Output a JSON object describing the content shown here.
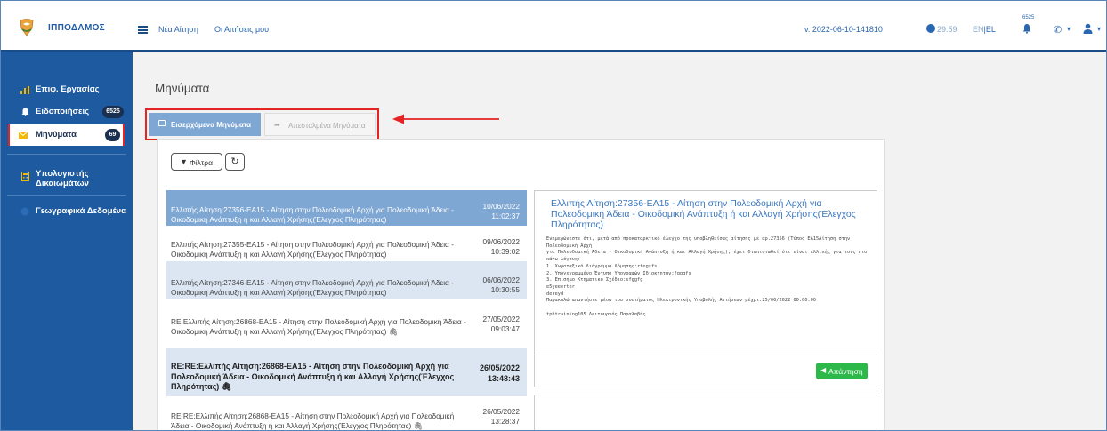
{
  "header": {
    "brand": "ΙΠΠΟΔΑΜΟΣ",
    "nav": [
      {
        "label": "Νέα Αίτηση"
      },
      {
        "label": "Οι Αιτήσεις μου"
      }
    ],
    "version": "v. 2022-06-10-141810",
    "timer": "29:59",
    "lang_en": "EN",
    "lang_sep": "|",
    "lang_el": "EL",
    "notifications_count": "6525"
  },
  "sidebar": {
    "items": [
      {
        "label": "Επιφ. Εργασίας",
        "icon": "bar-chart-icon"
      },
      {
        "label": "Ειδοποιήσεις",
        "badge": "6525",
        "icon": "bell-icon"
      },
      {
        "label": "Μηνύματα",
        "badge": "69",
        "icon": "envelope-icon"
      },
      {
        "label": "Υπολογιστής Δικαιωμάτων",
        "icon": "calculator-icon"
      },
      {
        "label": "Γεωγραφικά Δεδομένα",
        "icon": "globe-icon"
      }
    ]
  },
  "page": {
    "title": "Μηνύματα",
    "tabs": {
      "inbox": "Εισερχόμενα Μηνύματα",
      "sent": "Απεσταλμένα Μηνύματα"
    },
    "filter_label": "Φίλτρα",
    "refresh_icon": "refresh-icon"
  },
  "messages": [
    {
      "subject": "Ελλιπής Αίτηση:27356-ΕΑ15 - Αίτηση στην Πολεοδομική Αρχή για Πολεοδομική Άδεια - Οικοδομική Ανάπτυξη ή και Αλλαγή Χρήσης(Έλεγχος Πληρότητας)",
      "date": "10/06/2022",
      "time": "11:02:37"
    },
    {
      "subject": "Ελλιπής Αίτηση:27355-ΕΑ15 - Αίτηση στην Πολεοδομική Αρχή για Πολεοδομική Άδεια - Οικοδομική Ανάπτυξη ή και Αλλαγή Χρήσης(Έλεγχος Πληρότητας)",
      "date": "09/06/2022",
      "time": "10:39:02"
    },
    {
      "subject": "Ελλιπής Αίτηση:27346-ΕΑ15 - Αίτηση στην Πολεοδομική Αρχή για Πολεοδομική Άδεια - Οικοδομική Ανάπτυξη ή και Αλλαγή Χρήσης(Έλεγχος Πληρότητας)",
      "date": "06/06/2022",
      "time": "10:30:55"
    },
    {
      "subject": "RE:Ελλιπής Αίτηση:26868-ΕΑ15 - Αίτηση στην Πολεοδομική Αρχή για Πολεοδομική Άδεια - Οικοδομική Ανάπτυξη ή και Αλλαγή Χρήσης(Έλεγχος Πληρότητας)",
      "date": "27/05/2022",
      "time": "09:03:47"
    },
    {
      "subject": "RE:RE:Ελλιπής Αίτηση:26868-ΕΑ15 - Αίτηση στην Πολεοδομική Αρχή για Πολεοδομική Άδεια - Οικοδομική Ανάπτυξη ή και Αλλαγή Χρήσης(Έλεγχος Πληρότητας)",
      "date": "26/05/2022",
      "time": "13:48:43"
    },
    {
      "subject": "RE:RE:Ελλιπής Αίτηση:26868-ΕΑ15 - Αίτηση στην Πολεοδομική Αρχή για Πολεοδομική Άδεια - Οικοδομική Ανάπτυξη ή και Αλλαγή Χρήσης(Έλεγχος Πληρότητας)",
      "date": "26/05/2022",
      "time": "13:28:37"
    }
  ],
  "detail": {
    "title": "Ελλιπής Αίτηση:27356-ΕΑ15 - Αίτηση στην Πολεοδομική Αρχή για Πολεοδομική Άδεια - Οικοδομική Ανάπτυξη ή και Αλλαγή Χρήσης(Έλεγχος Πληρότητας)",
    "body": "Ενημερώνεστε ότι, μετά από προκαταρκτικό έλεγχο της υποβληθείσας αίτησης με αρ.27356 (Τύπος ΕΑ15Αίτηση στην Πολεοδομική Αρχή\nγια Πολεοδομική Άδεια - Οικοδομική Ανάπτυξη ή και Αλλαγή Χρήσης), έχει διαπιστωθεί ότι είναι ελλιπής για τους πιο κάτω λόγους:\n1. Χωροταξικό Διάγραμμα Δόμησης:rtegsfs\n2. Υπογεγραμμένο Έντυπο Υπογραφών Ιδιοκτητών:fgggfs\n3. Επίσημο Κτηματικό Σχέδιο:sfggfg\ne5yeeerter\ndereyd\nΠαρακαλώ απαντήστε μέσω του συστήματος Ηλεκτρονικής Υποβολής Αιτήσεων μέχρι:25/06/2022 00:00:00\n\ntphtraining105 Λειτουργός Παραλαβής",
    "reply_label": "Απάντηση"
  },
  "colors": {
    "primary": "#1d5aa0",
    "tab_active": "#7ea7d4",
    "highlight": "#e52224",
    "reply": "#2db84a"
  }
}
